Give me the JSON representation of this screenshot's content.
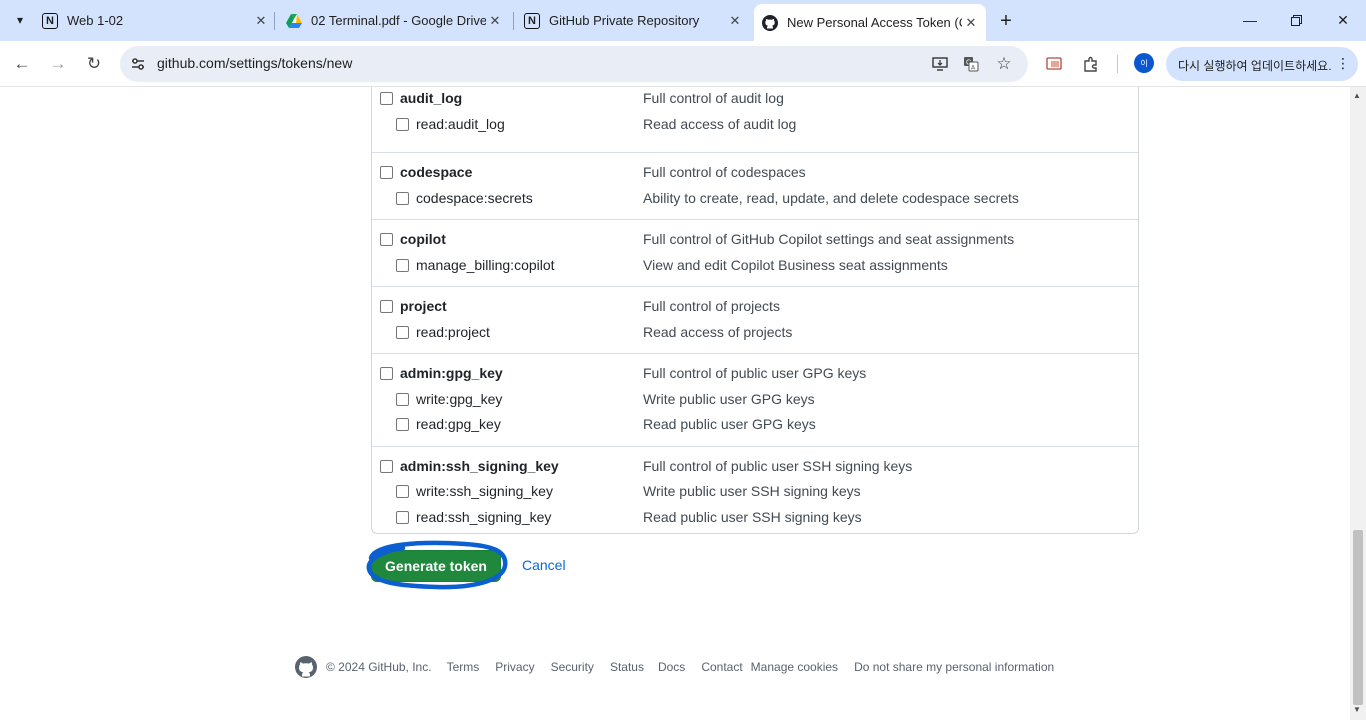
{
  "browser": {
    "tabs": [
      {
        "title": "Web 1-02",
        "favicon": "notion-icon"
      },
      {
        "title": "02 Terminal.pdf - Google Drive",
        "favicon": "google-drive-icon"
      },
      {
        "title": "GitHub Private Repository",
        "favicon": "notion-icon"
      },
      {
        "title": "New Personal Access Token (Classic)",
        "favicon": "github-icon",
        "active": true
      }
    ],
    "url": "github.com/settings/tokens/new",
    "update_label": "다시 실행하여 업데이트하세요.",
    "profile_initial": "이"
  },
  "scopes": [
    {
      "name": "audit_log",
      "desc": "Full control of audit log",
      "children": [
        {
          "name": "read:audit_log",
          "desc": "Read access of audit log"
        }
      ]
    },
    {
      "name": "codespace",
      "desc": "Full control of codespaces",
      "children": [
        {
          "name": "codespace:secrets",
          "desc": "Ability to create, read, update, and delete codespace secrets"
        }
      ]
    },
    {
      "name": "copilot",
      "desc": "Full control of GitHub Copilot settings and seat assignments",
      "children": [
        {
          "name": "manage_billing:copilot",
          "desc": "View and edit Copilot Business seat assignments"
        }
      ]
    },
    {
      "name": "project",
      "desc": "Full control of projects",
      "children": [
        {
          "name": "read:project",
          "desc": "Read access of projects"
        }
      ]
    },
    {
      "name": "admin:gpg_key",
      "desc": "Full control of public user GPG keys",
      "children": [
        {
          "name": "write:gpg_key",
          "desc": "Write public user GPG keys"
        },
        {
          "name": "read:gpg_key",
          "desc": "Read public user GPG keys"
        }
      ]
    },
    {
      "name": "admin:ssh_signing_key",
      "desc": "Full control of public user SSH signing keys",
      "children": [
        {
          "name": "write:ssh_signing_key",
          "desc": "Write public user SSH signing keys"
        },
        {
          "name": "read:ssh_signing_key",
          "desc": "Read public user SSH signing keys"
        }
      ]
    }
  ],
  "actions": {
    "generate_label": "Generate token",
    "cancel_label": "Cancel",
    "highlight_color": "#0b5fd0"
  },
  "footer": {
    "copyright": "© 2024 GitHub, Inc.",
    "links": [
      "Terms",
      "Privacy",
      "Security",
      "Status",
      "Docs",
      "Contact",
      "Manage cookies",
      "Do not share my personal information"
    ]
  }
}
